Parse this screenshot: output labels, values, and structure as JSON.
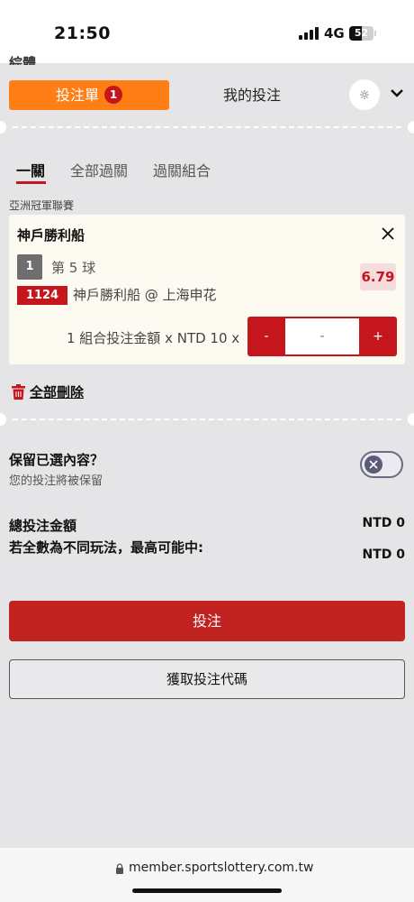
{
  "status_bar": {
    "time": "21:50",
    "network": "4G",
    "battery": "52",
    "battery_level": 0.52,
    "peek_text": "綜體"
  },
  "header": {
    "betslip_label": "投注單",
    "betslip_count": "1",
    "mybets_label": "我的投注",
    "settings_icon": "gear-icon",
    "collapse_icon": "chevron-down-icon"
  },
  "subtabs": {
    "items": [
      "一關",
      "全部過關",
      "過關組合"
    ],
    "active_index": 0
  },
  "league": "亞洲冠軍聯賽",
  "bet": {
    "selection": "神戶勝利船",
    "bet_number": "1",
    "market": "第 5 球",
    "odds": "6.79",
    "match_code": "1124",
    "match_name": "神戶勝利船 @ 上海申花",
    "stake_label": "1 組合投注金額 x NTD 10 x",
    "decrement_label": "-",
    "increment_label": "+",
    "amount_placeholder": "-"
  },
  "delete_all_label": "全部刪除",
  "keep_selection": {
    "title": "保留已選內容？",
    "subtitle": "您的投注將被保留",
    "enabled": false
  },
  "summary": {
    "total_label": "總投注金額",
    "total_value": "NTD 0",
    "max_win_label": "若全數為不同玩法，最高可能中:",
    "max_win_value": "NTD 0"
  },
  "buttons": {
    "place_bet": "投注",
    "get_code": "獲取投注代碼"
  },
  "browser": {
    "url": "member.sportslottery.com.tw"
  },
  "colors": {
    "accent_orange": "#ff7e15",
    "primary_red": "#c12321",
    "background": "#e5e5e7",
    "card": "#fcfaf1"
  }
}
